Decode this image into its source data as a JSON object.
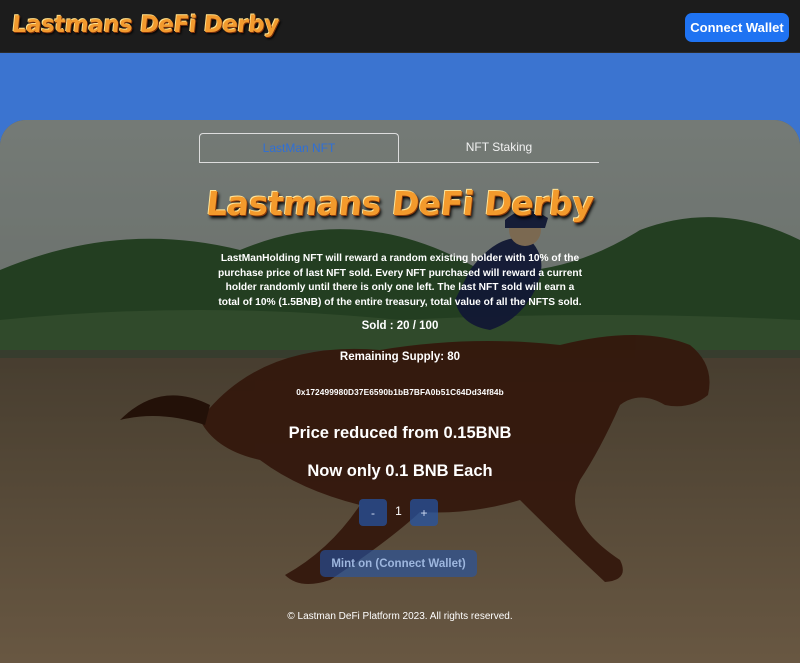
{
  "header": {
    "logo_text": "Lastmans DeFi Derby",
    "connect_label": "Connect Wallet"
  },
  "tabs": [
    {
      "label": "LastMan NFT",
      "active": true
    },
    {
      "label": "NFT Staking",
      "active": false
    }
  ],
  "main": {
    "logo_text": "Lastmans DeFi Derby",
    "description": "LastManHolding NFT will reward a random existing holder with 10% of the purchase price of last NFT sold. Every NFT purchased will reward a current holder randomly until there is only one left. The last NFT sold will earn a total of 10% (1.5BNB) of the entire treasury, total value of all the NFTS sold.",
    "sold": "Sold : 20 / 100",
    "remaining": "Remaining Supply: 80",
    "contract_address": "0x172499980D37E6590b1bB7BFA0b51C64Dd34f84b",
    "price_reduced": "Price reduced from 0.15BNB",
    "now_only": "Now only 0.1 BNB Each",
    "stepper": {
      "minus": "-",
      "quantity": "1",
      "plus": "+"
    },
    "mint_label": "Mint on (Connect Wallet)",
    "footer": "© Lastman DeFi Platform 2023. All rights reserved."
  },
  "colors": {
    "page_bg": "#3b74d0",
    "header_bg": "#1c1c1c",
    "accent_blue": "#1f73f2",
    "logo_orange": "#f29a2e"
  },
  "background_image": "horse-race-jockey-illustration"
}
